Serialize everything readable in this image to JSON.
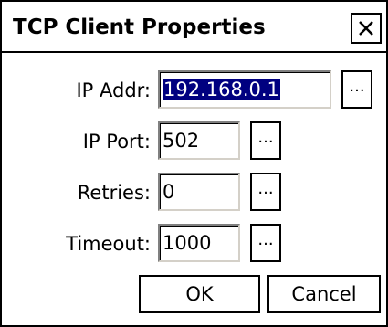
{
  "window": {
    "title": "TCP Client Properties",
    "close_icon": "close-icon"
  },
  "fields": [
    {
      "label": "IP Addr:",
      "value": "192.168.0.1",
      "selected": true,
      "browse": "..."
    },
    {
      "label": "IP Port:",
      "value": "502",
      "selected": false,
      "browse": "..."
    },
    {
      "label": "Retries:",
      "value": "0",
      "selected": false,
      "browse": "..."
    },
    {
      "label": "Timeout:",
      "value": "1000",
      "selected": false,
      "browse": "..."
    }
  ],
  "buttons": {
    "ok": "OK",
    "cancel": "Cancel"
  }
}
